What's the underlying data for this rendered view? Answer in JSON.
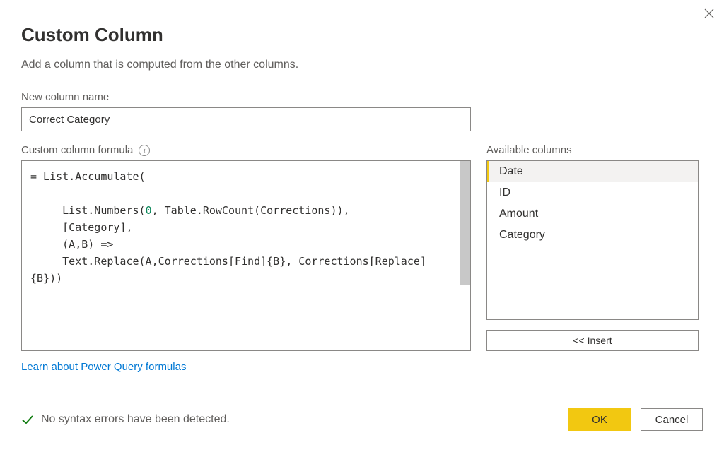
{
  "dialog": {
    "title": "Custom Column",
    "subtitle": "Add a column that is computed from the other columns."
  },
  "name_field": {
    "label": "New column name",
    "value": "Correct Category"
  },
  "formula_field": {
    "label": "Custom column formula",
    "info_glyph": "i",
    "value_prefix": "= ",
    "value_lines": [
      "List.Accumulate(",
      "",
      "     List.Numbers(",
      "0",
      ", Table.RowCount(Corrections)),",
      "     [Category],",
      "     (A,B) =>",
      "     Text.Replace(A,Corrections[Find]{B}, Corrections[Replace]{B}))"
    ],
    "learn_link": "Learn about Power Query formulas"
  },
  "available_columns": {
    "label": "Available columns",
    "items": [
      "Date",
      "ID",
      "Amount",
      "Category"
    ],
    "selected_index": 0,
    "insert_label": "<< Insert"
  },
  "status": {
    "text": "No syntax errors have been detected."
  },
  "buttons": {
    "ok": "OK",
    "cancel": "Cancel"
  }
}
